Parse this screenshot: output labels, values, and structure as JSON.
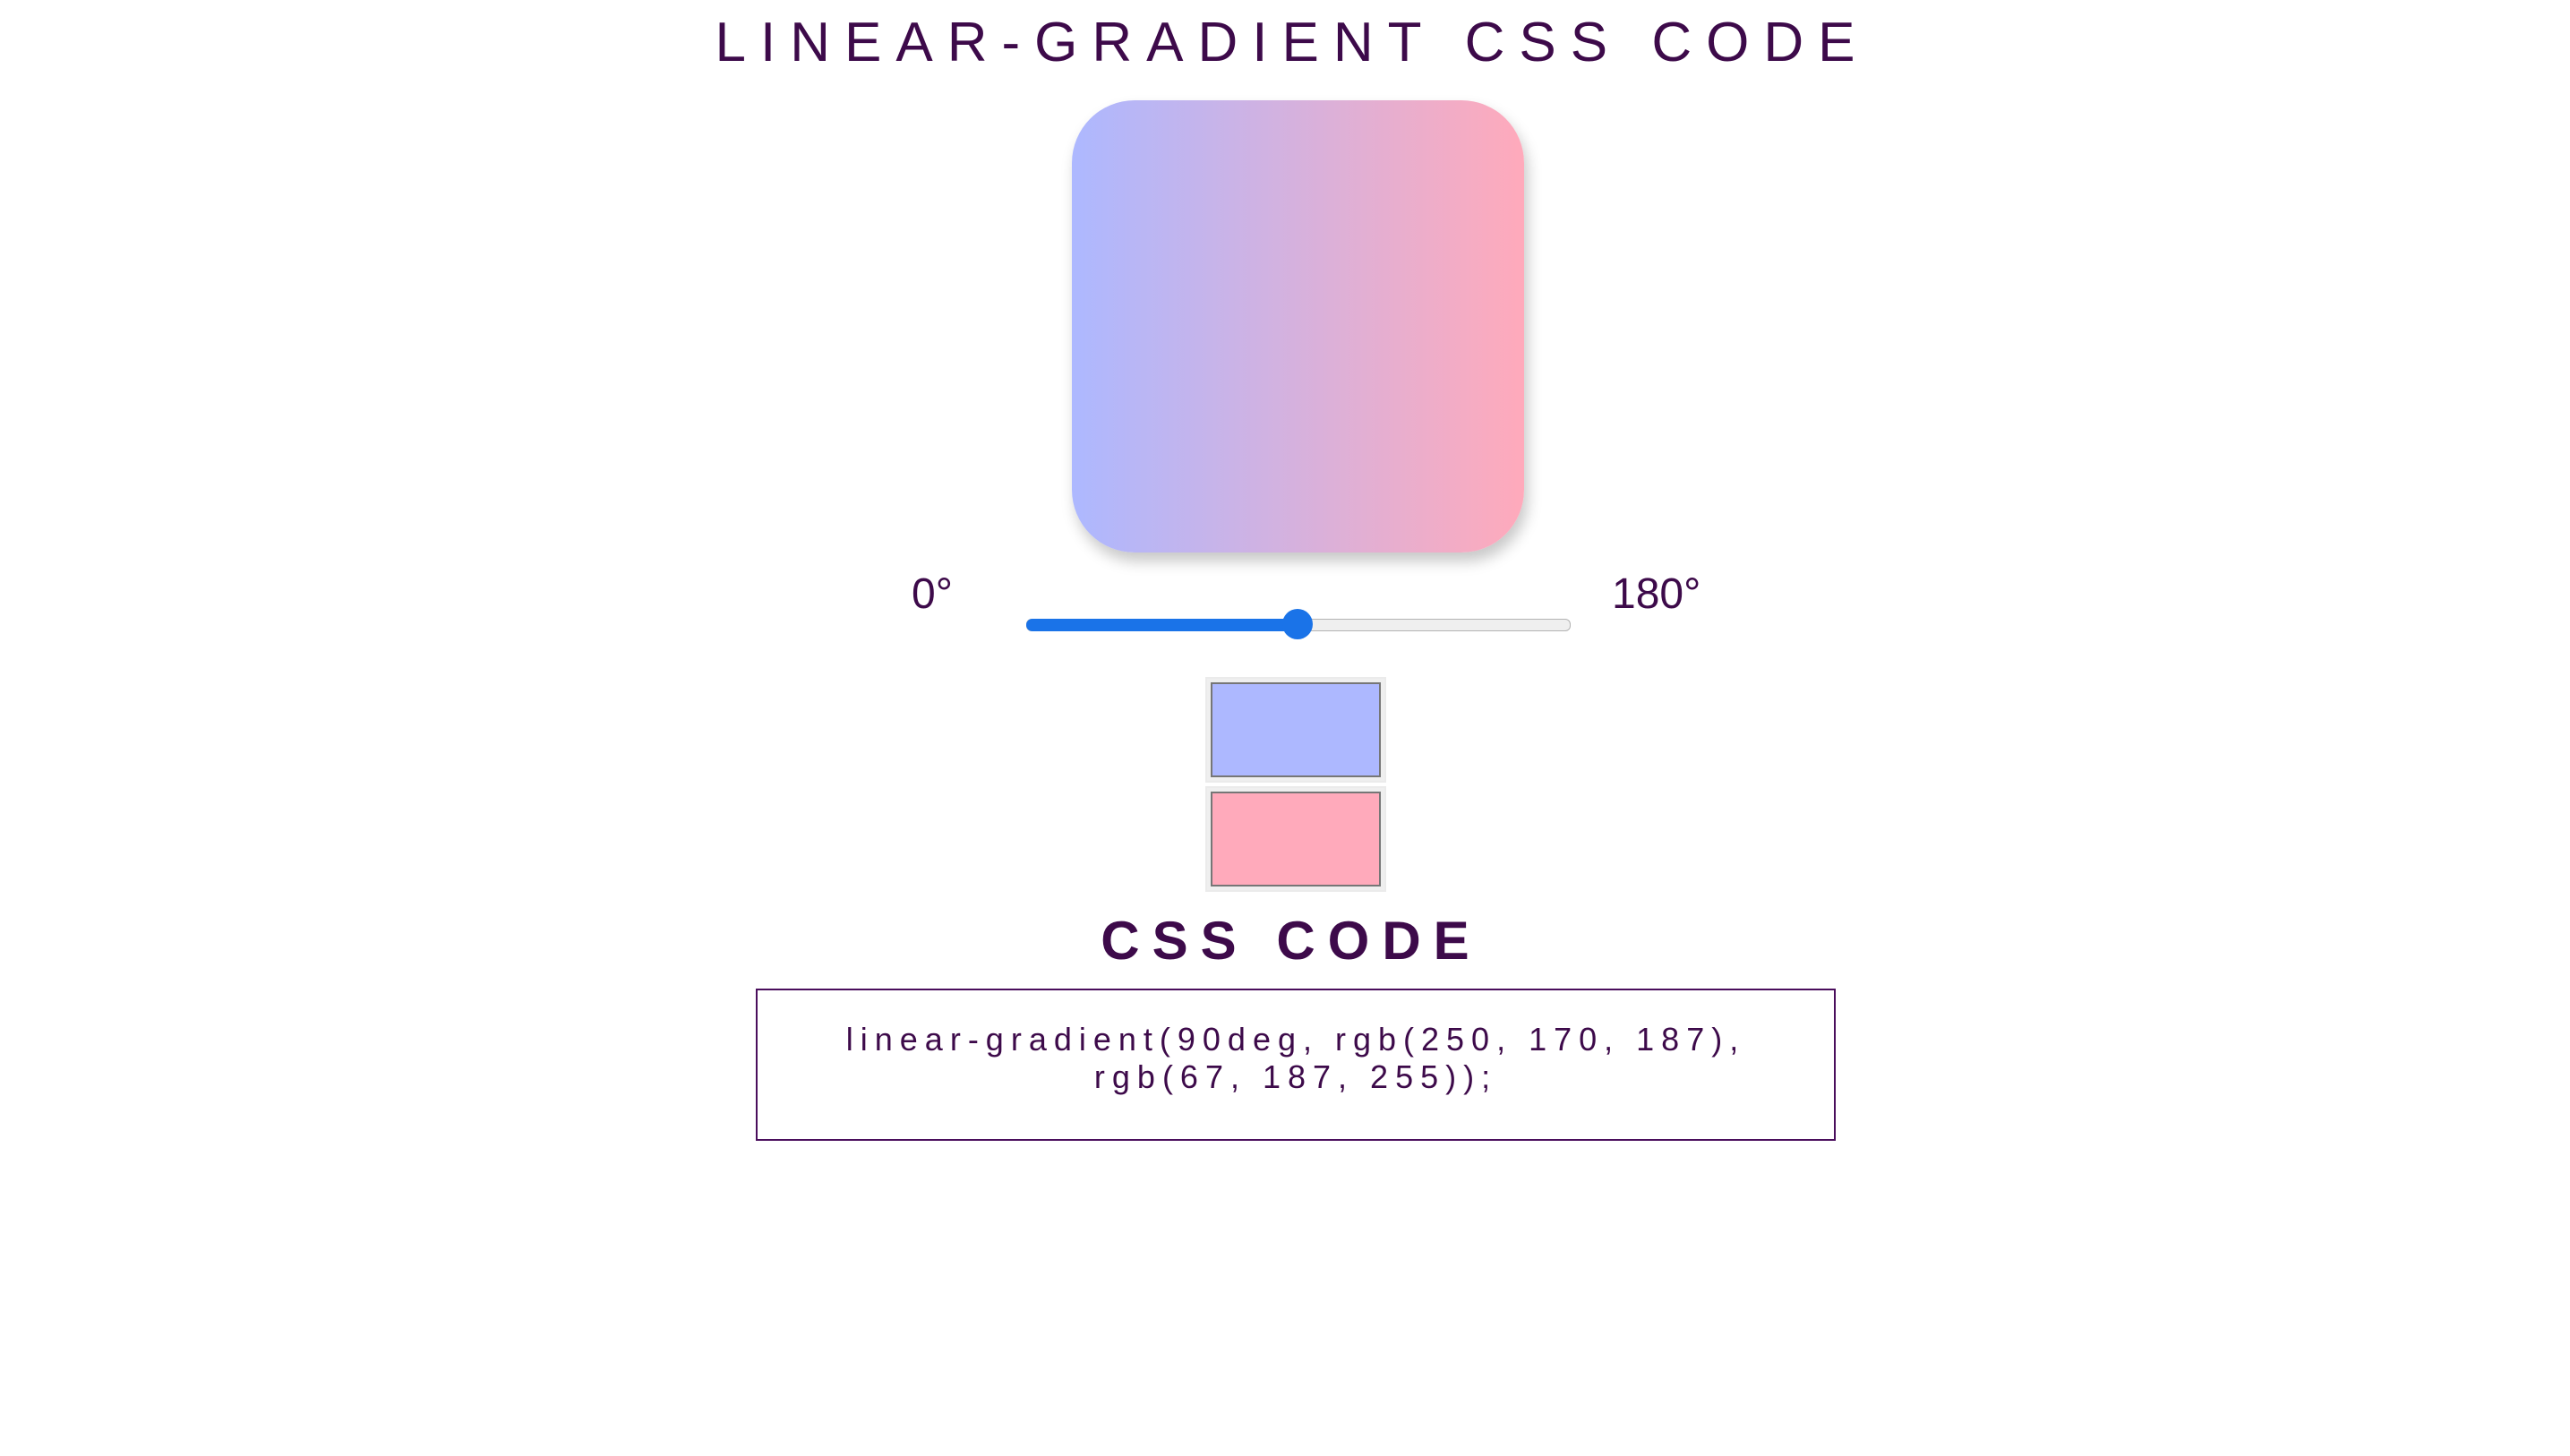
{
  "title": "LINEAR-GRADIENT CSS CODE",
  "gradient": {
    "angle_deg": 90,
    "color_start": "#adb8ff",
    "color_end": "#ffaabb"
  },
  "slider": {
    "min_label": "0°",
    "max_label": "180°",
    "min": 0,
    "max": 180,
    "value": 90,
    "accent": "#1a73e8"
  },
  "color_inputs": [
    {
      "value": "#adb8ff"
    },
    {
      "value": "#ffaabb"
    }
  ],
  "css_code_heading": "CSS CODE",
  "css_code_text": "linear-gradient(90deg, rgb(250, 170, 187), rgb(67, 187, 255));",
  "text_color": "#3d0a4a"
}
